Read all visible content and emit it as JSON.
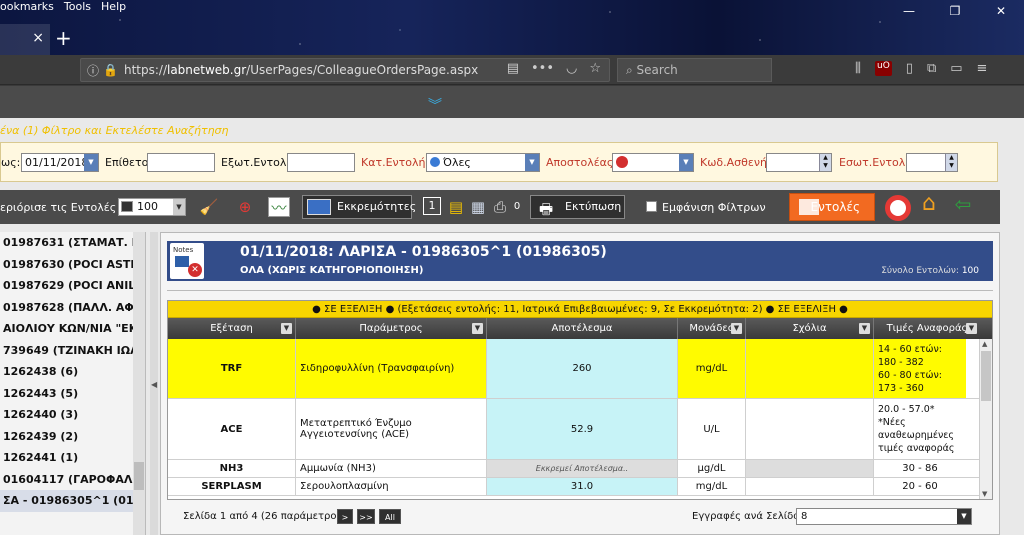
{
  "browser": {
    "menu": [
      "ookmarks",
      "Tools",
      "Help"
    ],
    "tab_close": "×",
    "new_tab": "+",
    "url_prefix": "https://",
    "url_domain": "labnetweb.gr",
    "url_path": "/UserPages/ColleagueOrdersPage.aspx",
    "search_placeholder": "Search",
    "win_controls": [
      "—",
      "❐",
      "✕"
    ]
  },
  "hint": "ένα (1) Φίλτρο και Εκτελέστε Αναζήτηση",
  "filters": {
    "date_label": "ως:",
    "date_value": "01/11/2018",
    "surname_label": "Επίθετο:",
    "ext_order_label": "Εξωτ.Εντολή:",
    "category_label": "Κατ.Εντολής:",
    "category_value": "Όλες",
    "sender_label": "Αποστολέας:",
    "patient_code_label": "Κωδ.Ασθενή:",
    "int_order_label": "Εσωτ.Εντολή:"
  },
  "toolbar": {
    "limit_label": "εριόρισε τις Εντολές σε:",
    "page_size": "100",
    "pending_button": "Εκκρεμότητες",
    "count_badge": "1",
    "count_value": "0",
    "print_button": "Εκτύπωση",
    "show_filters_label": "Εμφάνιση Φίλτρων",
    "orders_button": "Εντολές"
  },
  "sidebar": {
    "items": [
      "01987631 (ΣΤΑΜΑΤ. Ελ",
      "01987630 (POCI ASTRI",
      "01987629 (POCI ANILA",
      "01987628 (ΠΑΛΛ. ΑΦΡ",
      "ΑΙΟΛΙΟΥ ΚΩΝ/ΝΙΑ \"ΕΚΤ",
      "739649 (ΤΖΙΝΑΚΗ ΙΩΑΝ",
      "1262438 (6)",
      "1262443 (5)",
      "1262440 (3)",
      "1262439 (2)",
      "1262441 (1)",
      "01604117 (ΓΑΡΟΦΑΛΟ",
      "ΣΑ - 01986305^1 (019("
    ]
  },
  "header": {
    "notes_label": "Notes",
    "title": "01/11/2018: ΛΑΡΙΣΑ - 01986305^1 (01986305)",
    "subtitle": "ΟΛΑ (ΧΩΡΙΣ ΚΑΤΗΓΟΡΙΟΠΟΙΗΣΗ)",
    "total_label": "Σύνολο Εντολών:",
    "total_value": "100"
  },
  "grid": {
    "status": "● ΣΕ ΕΞΕΛΙΞΗ ● (Εξετάσεις εντολής: 11, Ιατρικά Επιβεβαιωμένες: 9, Σε Εκκρεμότητα: 2) ● ΣΕ ΕΞΕΛΙΞΗ ●",
    "columns": [
      "Εξέταση",
      "Παράμετρος",
      "Αποτέλεσμα",
      "Μονάδες",
      "Σχόλια",
      "Τιμές Αναφοράς"
    ],
    "rows": [
      {
        "exam": "TRF",
        "param": "Σιδηροφυλλίνη (Τρανσφαιρίνη)",
        "result": "260",
        "units": "mg/dL",
        "comments": "",
        "ref": "14 - 60 ετών: 180 - 382\n60 - 80 ετών: 173 - 360"
      },
      {
        "exam": "ACE",
        "param": "Μετατρεπτικό Ένζυμο Αγγειοτενσίνης (ACE)",
        "result": "52.9",
        "units": "U/L",
        "comments": "",
        "ref": "20.0 - 57.0*\n*Νέες αναθεωρημένες τιμές αναφοράς"
      },
      {
        "exam": "NH3",
        "param": "Αμμωνία (NH3)",
        "result": "Εκκρεμεί Αποτέλεσμα..",
        "units": "μg/dL",
        "comments": "",
        "ref": "30 - 86"
      },
      {
        "exam": "SERPLASM",
        "param": "Σερουλοπλασμίνη",
        "result": "31.0",
        "units": "mg/dL",
        "comments": "",
        "ref": "20 - 60"
      }
    ]
  },
  "pager": {
    "page_text": "Σελίδα 1 από 4 (26 παράμετροι)",
    "next": ">",
    "last": ">>",
    "all": "All",
    "rpp_label": "Εγγραφές ανά Σελίδα:",
    "rpp_value": "8"
  },
  "colors": {
    "accent_orange": "#f26a21",
    "header_blue": "#334d8a",
    "status_yellow": "#f7d500",
    "result_cyan": "#c7f3f7"
  }
}
